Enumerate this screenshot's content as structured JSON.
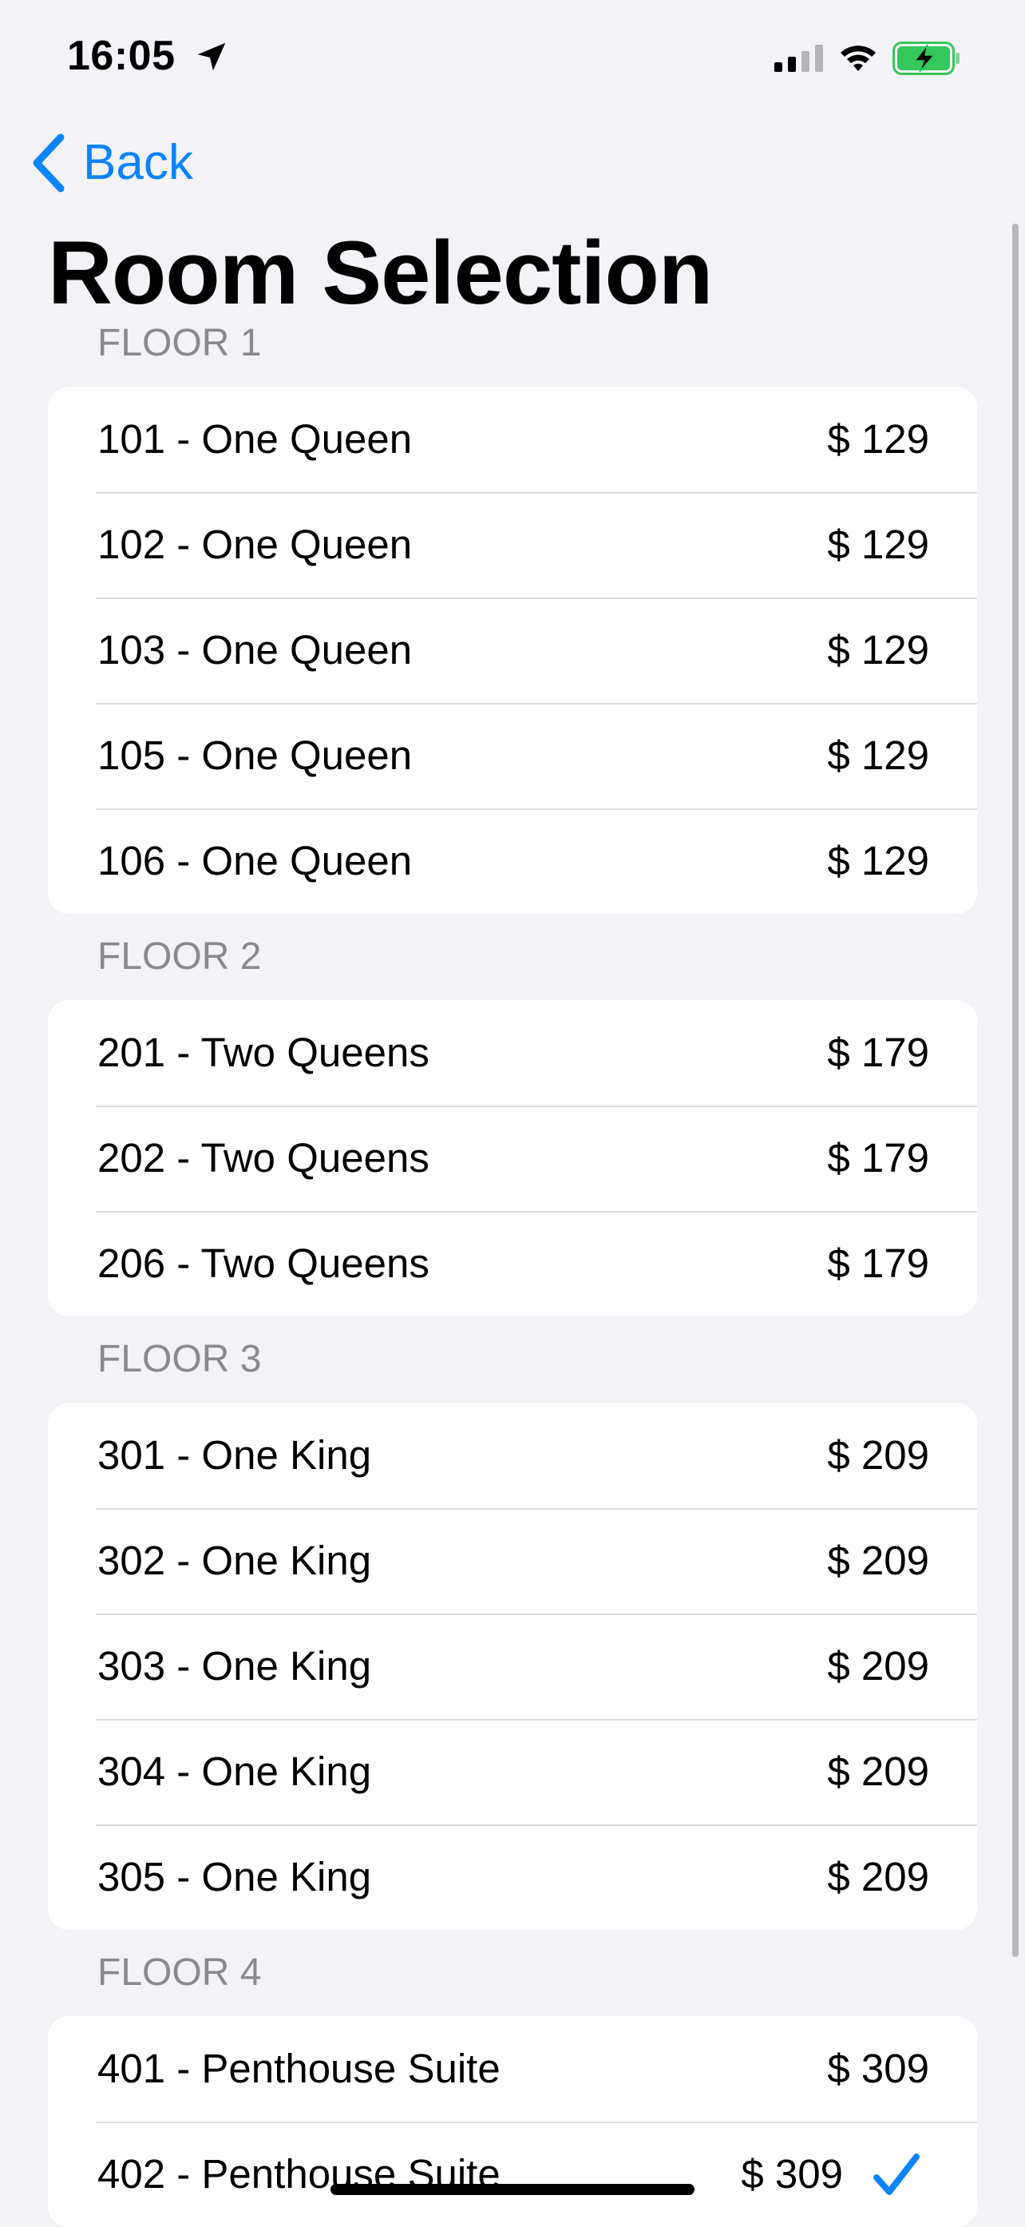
{
  "status_bar": {
    "time": "16:05",
    "location_icon": "location-arrow-icon",
    "signal_icon": "cellular-signal-icon",
    "wifi_icon": "wifi-icon",
    "battery_icon": "battery-charging-icon",
    "battery_color": "#34c759"
  },
  "nav": {
    "back_label": "Back",
    "back_icon": "chevron-left-icon",
    "accent_color": "#0a84ff"
  },
  "page_title": "Room Selection",
  "sections": [
    {
      "header": "FLOOR 1",
      "rooms": [
        {
          "name": "101 - One Queen",
          "price": "$ 129"
        },
        {
          "name": "102 - One Queen",
          "price": "$ 129"
        },
        {
          "name": "103 - One Queen",
          "price": "$ 129"
        },
        {
          "name": "105 - One Queen",
          "price": "$ 129"
        },
        {
          "name": "106 - One Queen",
          "price": "$ 129"
        }
      ]
    },
    {
      "header": "FLOOR 2",
      "rooms": [
        {
          "name": "201 - Two Queens",
          "price": "$ 179"
        },
        {
          "name": "202 - Two Queens",
          "price": "$ 179"
        },
        {
          "name": "206 - Two Queens",
          "price": "$ 179"
        }
      ]
    },
    {
      "header": "FLOOR 3",
      "rooms": [
        {
          "name": "301 - One King",
          "price": "$ 209"
        },
        {
          "name": "302 - One King",
          "price": "$ 209"
        },
        {
          "name": "303 - One King",
          "price": "$ 209"
        },
        {
          "name": "304 - One King",
          "price": "$ 209"
        },
        {
          "name": "305 - One King",
          "price": "$ 209"
        }
      ]
    },
    {
      "header": "FLOOR 4",
      "rooms": [
        {
          "name": "401 - Penthouse Suite",
          "price": "$ 309"
        },
        {
          "name": "402 - Penthouse Suite",
          "price": "$ 309",
          "selected": true,
          "selected_icon": "checkmark-icon"
        }
      ]
    }
  ]
}
